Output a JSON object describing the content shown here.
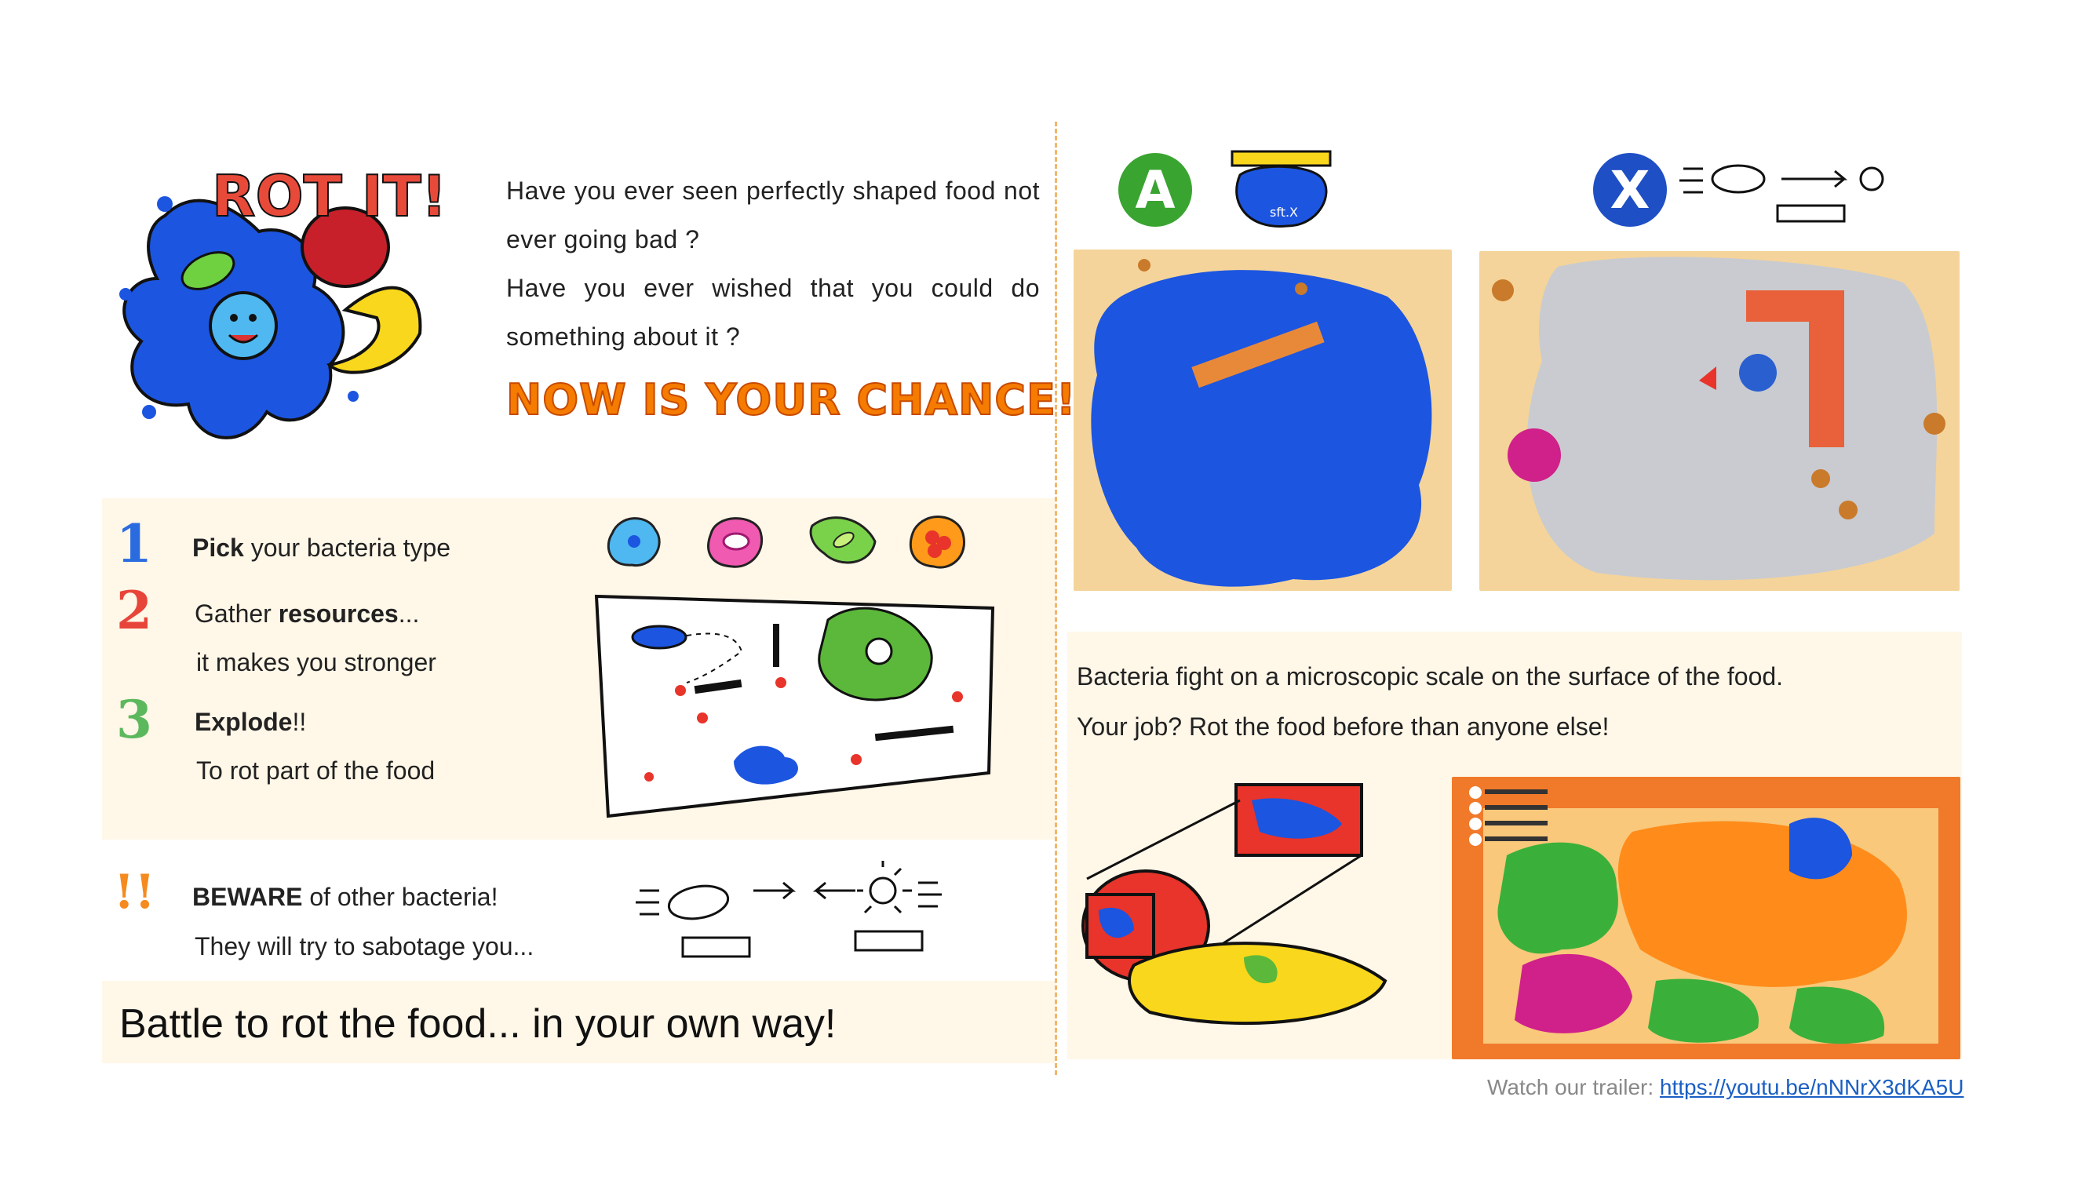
{
  "logo": {
    "text": "ROT IT!"
  },
  "intro": {
    "line1": "Have you ever seen perfectly shaped food not ever going bad ?",
    "line2": "Have you ever wished that you could do something about it ?",
    "slogan": "NOW IS YOUR CHANCE!"
  },
  "steps": [
    {
      "num": "1",
      "bold": "Pick",
      "text": " your bacteria type",
      "sub": ""
    },
    {
      "num": "2",
      "pre": "Gather ",
      "bold": "resources",
      "text": "...",
      "sub": "it makes you stronger"
    },
    {
      "num": "3",
      "bold": "Explode",
      "text": "!!",
      "sub": "To rot part of the food"
    }
  ],
  "beware": {
    "num": "!!",
    "bold": "BEWARE",
    "text": " of other bacteria!",
    "sub": "They will try to sabotage you..."
  },
  "battle": "Battle to rot the food... in your own way!",
  "buttons": {
    "a": "A",
    "x": "X"
  },
  "badge_label": "sft.X",
  "description": {
    "line1": "Bacteria fight on a microscopic scale on the surface of the food.",
    "line2": "Your job? Rot the food before than anyone else!"
  },
  "trailer": {
    "label": "Watch our trailer: ",
    "url": "https://youtu.be/nNNrX3dKA5U"
  },
  "colors": {
    "accent": "#f57c00",
    "a_button": "#3aa431",
    "x_button": "#1f4fc4",
    "bacteria_blue": "#1c55e0"
  }
}
